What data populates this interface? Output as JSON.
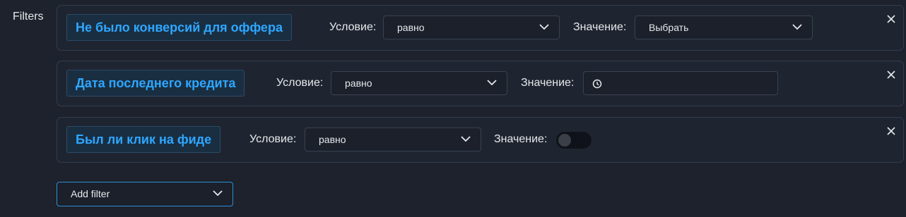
{
  "section": {
    "label": "Filters"
  },
  "filters": [
    {
      "name": "Не было конверсий для оффера",
      "condition_label": "Условие:",
      "condition_value": "равно",
      "value_label": "Значение:",
      "value_type": "select",
      "value_display": "Выбрать"
    },
    {
      "name": "Дата последнего кредита",
      "condition_label": "Условие:",
      "condition_value": "равно",
      "value_label": "Значение:",
      "value_type": "date",
      "value_display": ""
    },
    {
      "name": "Был ли клик на фиде",
      "condition_label": "Условие:",
      "condition_value": "равно",
      "value_label": "Значение:",
      "value_type": "toggle",
      "toggle_on": false
    }
  ],
  "add_filter": {
    "label": "Add filter"
  },
  "icons": {
    "close": "close-icon",
    "chevron": "chevron-down-icon",
    "clock": "clock-icon"
  },
  "colors": {
    "background": "#1d222c",
    "card_border": "#2f3e55",
    "accent": "#2ea7ff",
    "add_filter_border": "#2d8ed8"
  }
}
